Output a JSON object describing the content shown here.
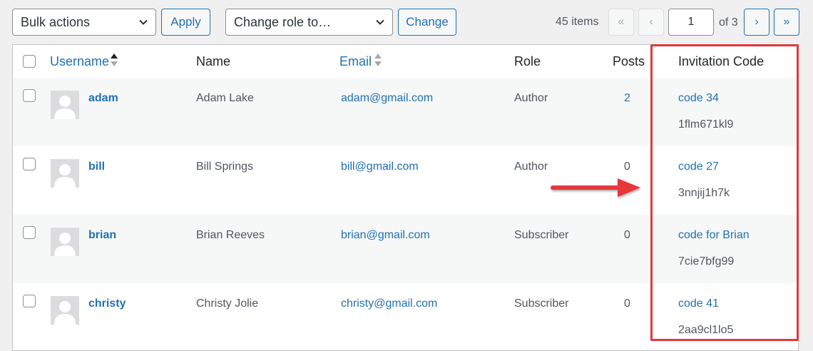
{
  "toolbar": {
    "bulk_actions": "Bulk actions",
    "apply_label": "Apply",
    "change_role": "Change role to…",
    "change_label": "Change"
  },
  "pagination": {
    "items_count": "45 items",
    "first": "«",
    "prev": "‹",
    "current_page": "1",
    "of_total": "of 3",
    "next": "›",
    "last": "»"
  },
  "columns": {
    "username": "Username",
    "name": "Name",
    "email": "Email",
    "role": "Role",
    "posts": "Posts",
    "invitation_code": "Invitation Code"
  },
  "rows": [
    {
      "username": "adam",
      "name": "Adam Lake",
      "email": "adam@gmail.com",
      "role": "Author",
      "posts": "2",
      "code_label": "code 34",
      "code_value": "1flm671kl9"
    },
    {
      "username": "bill",
      "name": "Bill Springs",
      "email": "bill@gmail.com",
      "role": "Author",
      "posts": "0",
      "code_label": "code 27",
      "code_value": "3nnjij1h7k"
    },
    {
      "username": "brian",
      "name": "Brian Reeves",
      "email": "brian@gmail.com",
      "role": "Subscriber",
      "posts": "0",
      "code_label": "code for Brian",
      "code_value": "7cie7bfg99"
    },
    {
      "username": "christy",
      "name": "Christy Jolie",
      "email": "christy@gmail.com",
      "role": "Subscriber",
      "posts": "0",
      "code_label": "code 41",
      "code_value": "2aa9cl1lo5"
    }
  ],
  "colors": {
    "accent": "#2271b1",
    "highlight": "#e5383b"
  },
  "icons": {
    "select_chevron": "chevron-down-icon",
    "sort_asc": "sort-ascending-icon",
    "sort_both": "sort-icon",
    "avatar": "user-avatar-icon",
    "annotation": "arrow-right-icon"
  }
}
